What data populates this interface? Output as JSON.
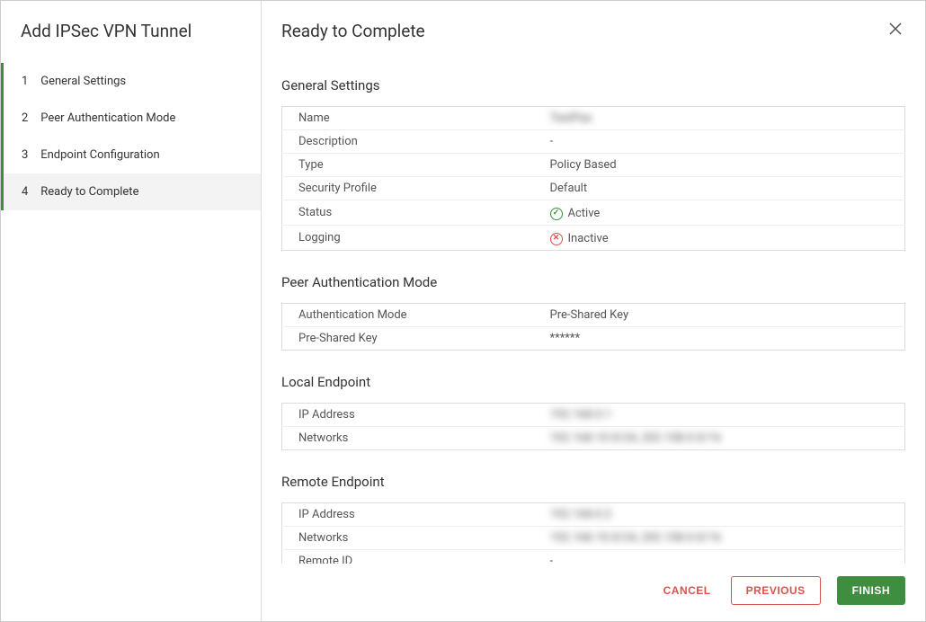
{
  "sidebar": {
    "title": "Add IPSec VPN Tunnel",
    "steps": [
      {
        "num": "1",
        "label": "General Settings"
      },
      {
        "num": "2",
        "label": "Peer Authentication Mode"
      },
      {
        "num": "3",
        "label": "Endpoint Configuration"
      },
      {
        "num": "4",
        "label": "Ready to Complete"
      }
    ]
  },
  "main": {
    "title": "Ready to Complete"
  },
  "sections": {
    "general": {
      "title": "General Settings",
      "rows": {
        "name_label": "Name",
        "name_value": "TestPas",
        "description_label": "Description",
        "description_value": "-",
        "type_label": "Type",
        "type_value": "Policy Based",
        "security_profile_label": "Security Profile",
        "security_profile_value": "Default",
        "status_label": "Status",
        "status_value": "Active",
        "logging_label": "Logging",
        "logging_value": "Inactive"
      }
    },
    "peer_auth": {
      "title": "Peer Authentication Mode",
      "rows": {
        "auth_mode_label": "Authentication Mode",
        "auth_mode_value": "Pre-Shared Key",
        "psk_label": "Pre-Shared Key",
        "psk_value": "******"
      }
    },
    "local_endpoint": {
      "title": "Local Endpoint",
      "rows": {
        "ip_label": "IP Address",
        "ip_value": "192.168.0.1",
        "networks_label": "Networks",
        "networks_value": "192.168.10.0/24, 202.108.0.0/16"
      }
    },
    "remote_endpoint": {
      "title": "Remote Endpoint",
      "rows": {
        "ip_label": "IP Address",
        "ip_value": "192.168.0.2",
        "networks_label": "Networks",
        "networks_value": "192.168.10.0/24, 202.108.0.0/16",
        "remote_id_label": "Remote ID",
        "remote_id_value": "-"
      }
    }
  },
  "footer": {
    "cancel": "CANCEL",
    "previous": "PREVIOUS",
    "finish": "FINISH"
  }
}
